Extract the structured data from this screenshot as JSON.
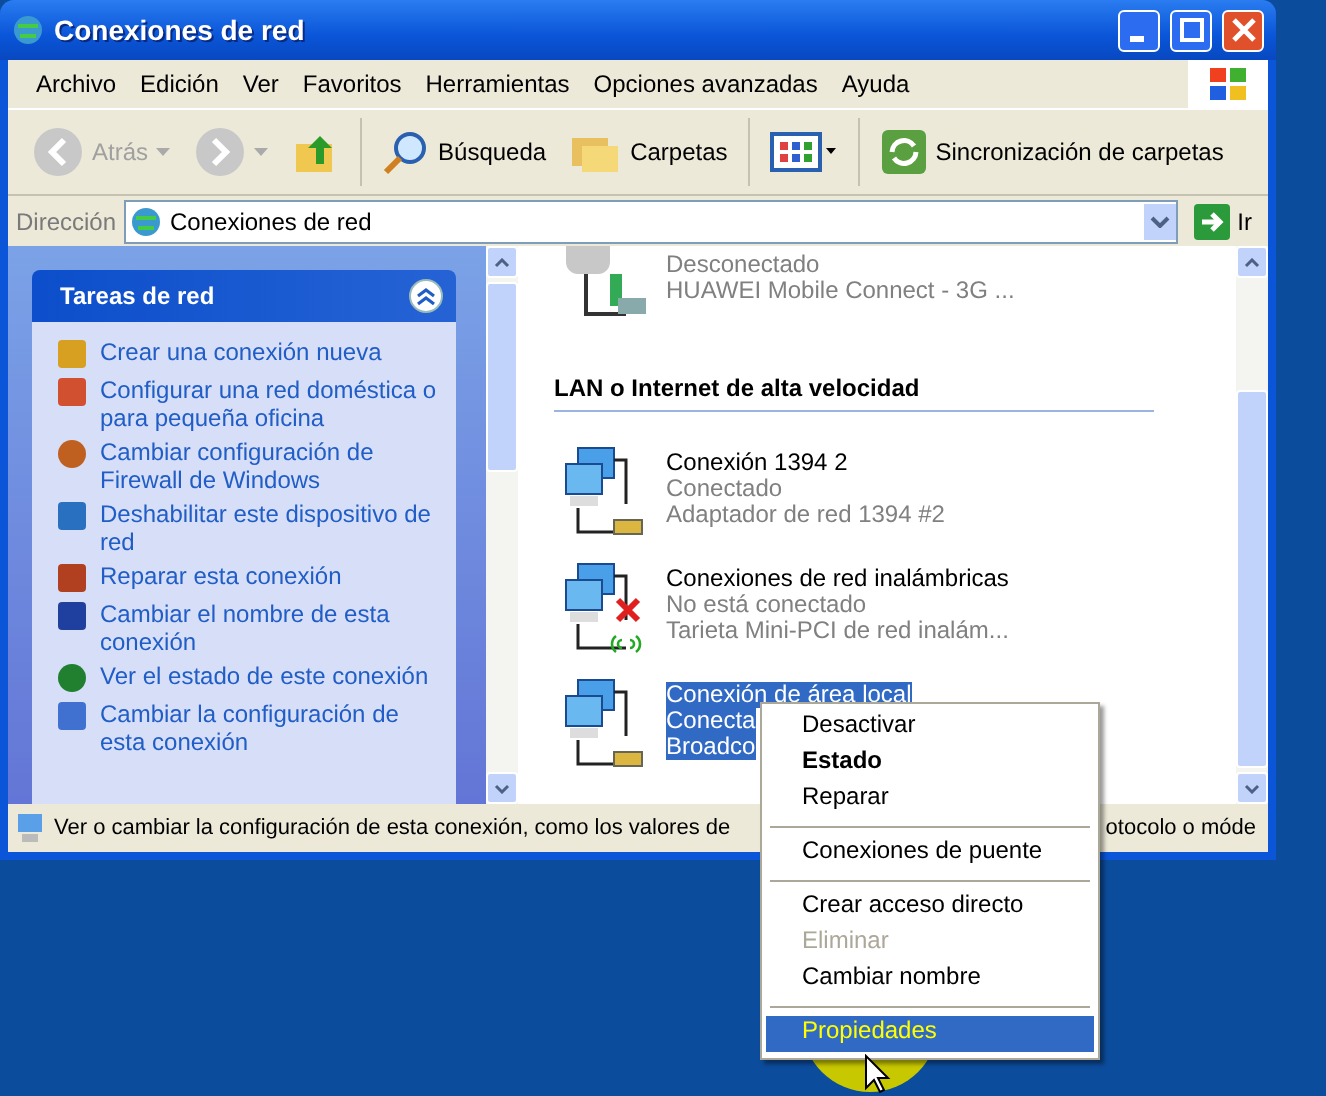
{
  "window": {
    "title": "Conexiones de red"
  },
  "menu_bar": [
    "Archivo",
    "Edición",
    "Ver",
    "Favoritos",
    "Herramientas",
    "Opciones avanzadas",
    "Ayuda"
  ],
  "toolbar": [
    {
      "kind": "back",
      "label": "Atrás",
      "disabled": true
    },
    {
      "kind": "forward",
      "disabled": true
    },
    {
      "kind": "up"
    },
    {
      "kind": "search",
      "label": "Búsqueda"
    },
    {
      "kind": "folders",
      "label": "Carpetas"
    },
    {
      "kind": "views"
    },
    {
      "kind": "sync",
      "label": "Sincronización de carpetas"
    }
  ],
  "address_bar": {
    "label": "Dirección",
    "value": "Conexiones de red",
    "go": "Ir"
  },
  "task_panel": {
    "title": "Tareas de red",
    "items": [
      {
        "kind": "new",
        "text": "Crear una conexión nueva"
      },
      {
        "kind": "home",
        "text": "Configurar una red doméstica o para pequeña oficina"
      },
      {
        "kind": "firewall",
        "text": "Cambiar configuración de Firewall de Windows"
      },
      {
        "kind": "disable",
        "text": "Deshabilitar este dispositivo de red"
      },
      {
        "kind": "repair",
        "text": "Reparar esta conexión"
      },
      {
        "kind": "rename",
        "text": "Cambiar el nombre de esta conexión"
      },
      {
        "kind": "status",
        "text": "Ver el estado de este conexión"
      },
      {
        "kind": "settings",
        "text": "Cambiar la configuración de esta conexión"
      }
    ]
  },
  "connections_top": [
    {
      "kind": "modem",
      "lines": [
        "Desconectado",
        "HUAWEI Mobile Connect - 3G ..."
      ],
      "selected": false
    }
  ],
  "group_title": "LAN o Internet de alta velocidad",
  "connections": [
    {
      "kind": "wired",
      "name": "Conexión 1394 2",
      "lines": [
        "Conectado",
        "Adaptador de red 1394 #2"
      ],
      "selected": false,
      "error": false
    },
    {
      "kind": "wireless",
      "name": "Conexiones de red inalámbricas",
      "lines": [
        "No está conectado",
        "Tarieta Mini-PCI de red inalám..."
      ],
      "selected": false,
      "error": true
    },
    {
      "kind": "wired",
      "name": "Conexión de área local",
      "lines": [
        "Conecta",
        "Broadco"
      ],
      "selected": true,
      "error": false
    }
  ],
  "status_bar": {
    "text": "Ver o cambiar la configuración de esta conexión, como los valores de",
    "text_end": "otocolo o móde"
  },
  "context_menu": [
    {
      "kind": "item",
      "label": "Desactivar",
      "bold": false,
      "disabled": false,
      "selected": false
    },
    {
      "kind": "item",
      "label": "Estado",
      "bold": true,
      "disabled": false,
      "selected": false
    },
    {
      "kind": "item",
      "label": "Reparar",
      "bold": false,
      "disabled": false,
      "selected": false
    },
    {
      "kind": "separator"
    },
    {
      "kind": "item",
      "label": "Conexiones de puente",
      "bold": false,
      "disabled": false,
      "selected": false
    },
    {
      "kind": "separator"
    },
    {
      "kind": "item",
      "label": "Crear acceso directo",
      "bold": false,
      "disabled": false,
      "selected": false
    },
    {
      "kind": "item",
      "label": "Eliminar",
      "bold": false,
      "disabled": true,
      "selected": false
    },
    {
      "kind": "item",
      "label": "Cambiar nombre",
      "bold": false,
      "disabled": false,
      "selected": false
    },
    {
      "kind": "separator"
    },
    {
      "kind": "item",
      "label": "Propiedades",
      "bold": false,
      "disabled": false,
      "selected": true
    }
  ]
}
